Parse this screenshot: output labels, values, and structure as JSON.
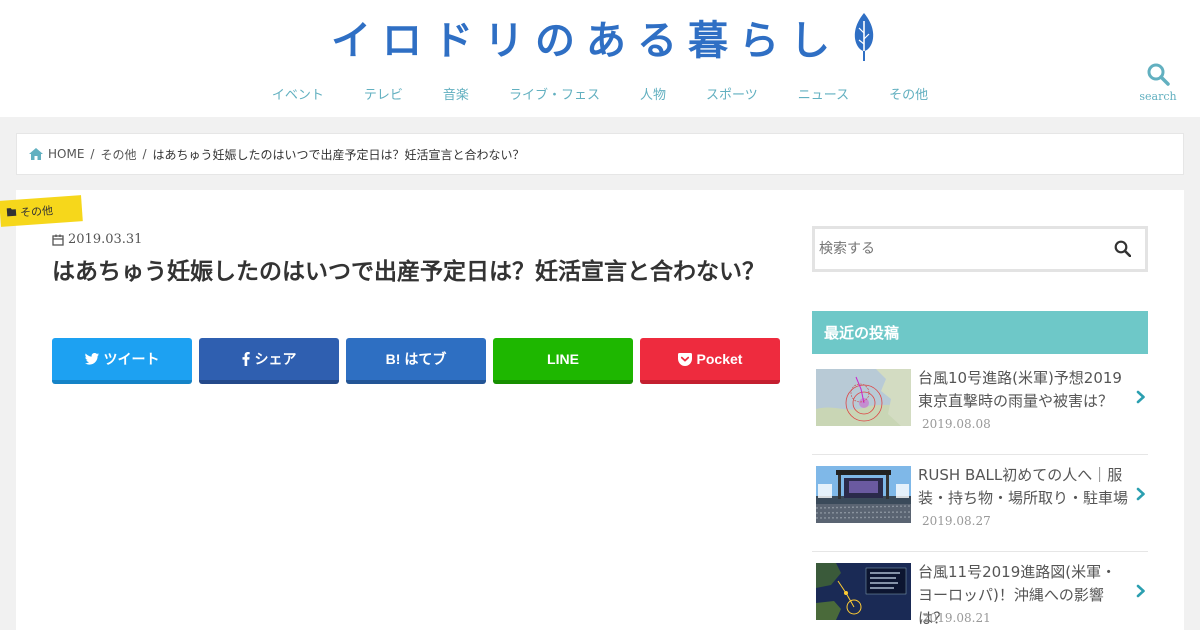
{
  "site": {
    "logo_text": "イロドリのある暮らし"
  },
  "nav": {
    "items": [
      "イベント",
      "テレビ",
      "音楽",
      "ライブ・フェス",
      "人物",
      "スポーツ",
      "ニュース",
      "その他"
    ]
  },
  "search": {
    "label": "search"
  },
  "breadcrumb": {
    "home": "HOME",
    "category": "その他",
    "current": "はあちゅう妊娠したのはいつで出産予定日は？妊活宣言と合わない？"
  },
  "article": {
    "category": "その他",
    "date": "2019.03.31",
    "title": "はあちゅう妊娠したのはいつで出産予定日は？妊活宣言と合わない？"
  },
  "share": {
    "tweet": "ツイート",
    "facebook": "シェア",
    "hatena": "B! はてブ",
    "line": "LINE",
    "pocket": "Pocket"
  },
  "sidebar": {
    "search_placeholder": "検索する",
    "recent_heading": "最近の投稿",
    "posts": [
      {
        "title": "台風10号進路(米軍)予想2019東京直撃時の雨量や被害は？",
        "date": "2019.08.08"
      },
      {
        "title": "RUSH BALL初めての人へ｜服装・持ち物・場所取り・駐車場",
        "date": "2019.08.27"
      },
      {
        "title": "台風11号2019進路図(米軍・ヨーロッパ)！沖縄への影響は？",
        "date": "2019.08.21"
      }
    ]
  },
  "colors": {
    "accent": "#62b0c0",
    "logo": "#2f6fc4",
    "badge": "#f6d71b",
    "sidebar_head": "#6ec8c8"
  }
}
